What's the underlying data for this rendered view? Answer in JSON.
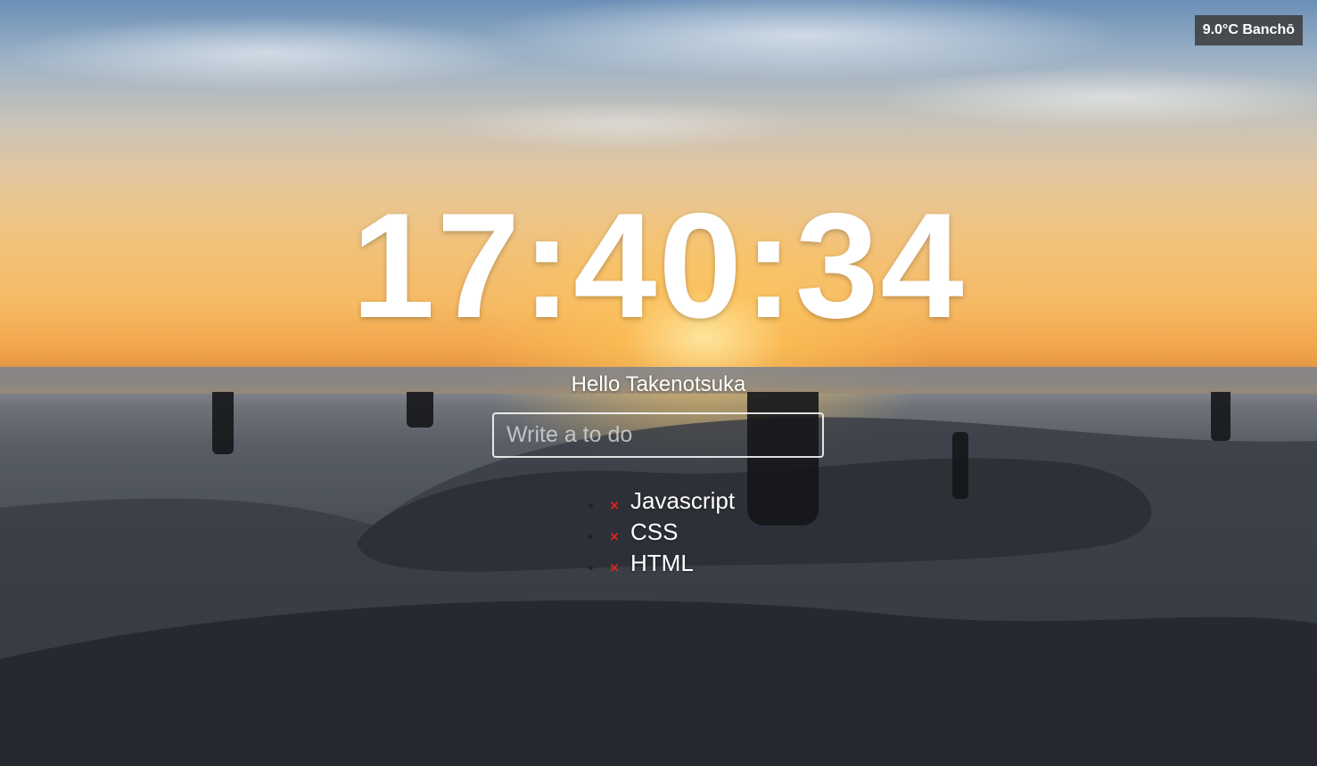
{
  "weather": {
    "text": "9.0°C Banchō"
  },
  "clock": {
    "time": "17:40:34"
  },
  "greeting": {
    "text": "Hello Takenotsuka"
  },
  "todo_form": {
    "placeholder": "Write a to do"
  },
  "todos": [
    {
      "delete_icon": "×",
      "label": "Javascript"
    },
    {
      "delete_icon": "×",
      "label": "CSS"
    },
    {
      "delete_icon": "×",
      "label": "HTML"
    }
  ],
  "colors": {
    "delete_icon": "#e2231a",
    "text": "#ffffff",
    "weather_bg": "#3c3c3c"
  }
}
